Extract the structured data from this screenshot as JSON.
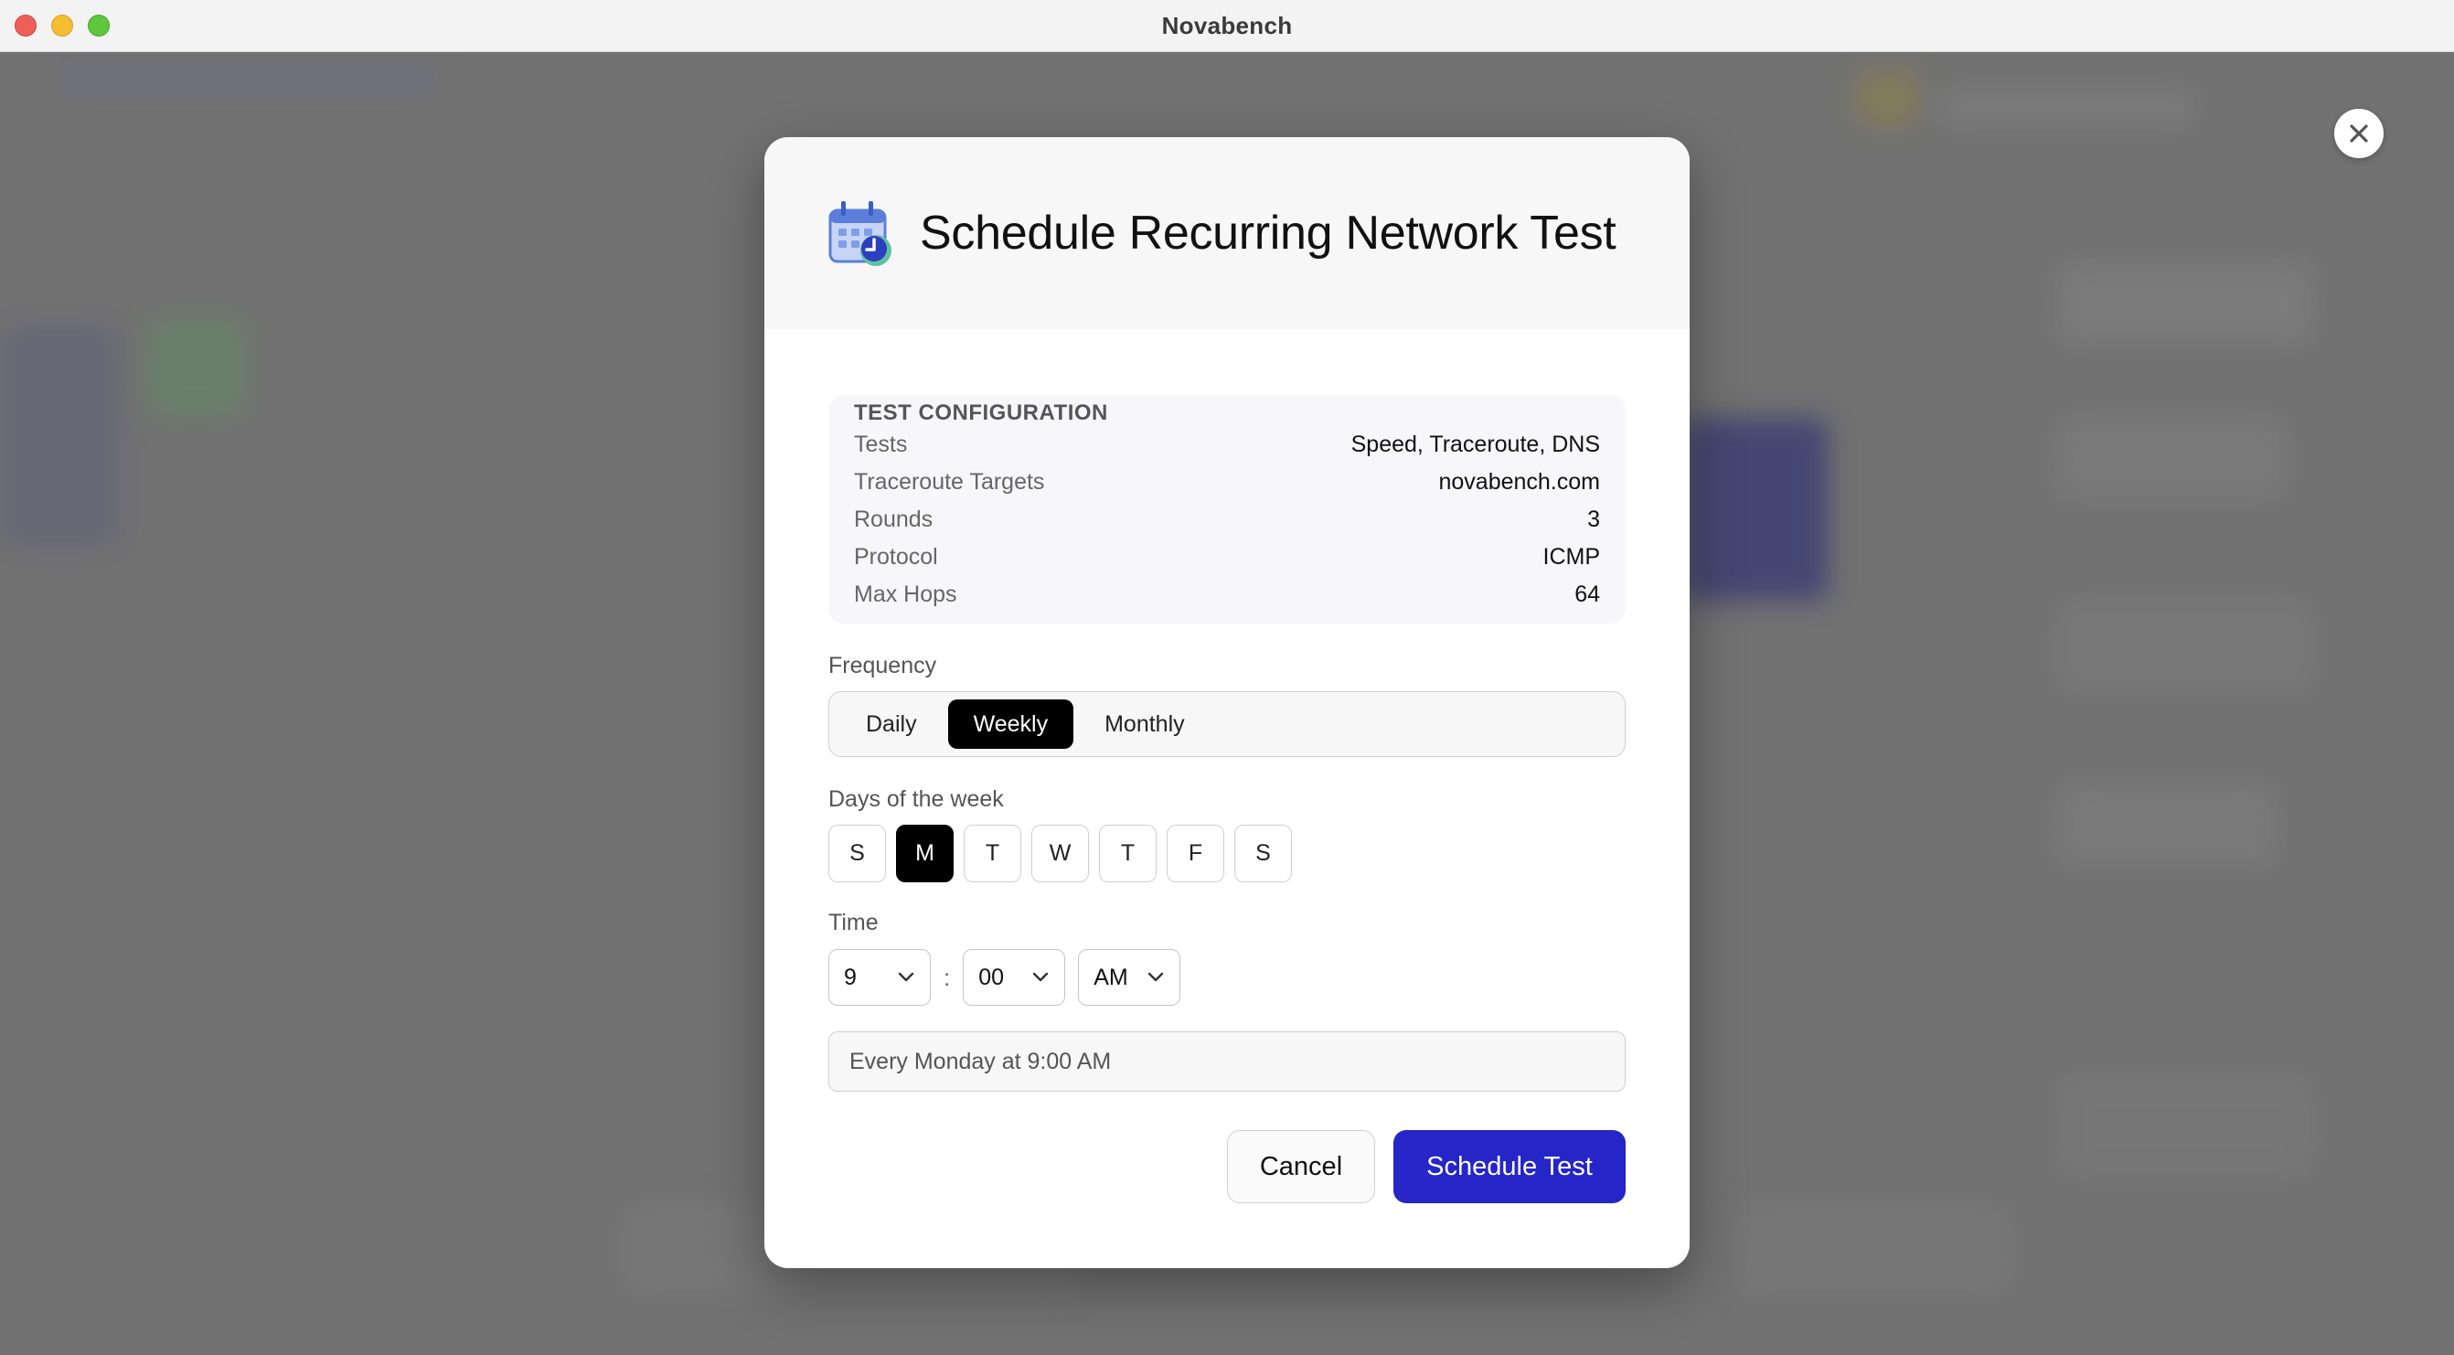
{
  "window": {
    "title": "Novabench"
  },
  "dialog": {
    "title": "Schedule Recurring Network Test",
    "icon": "calendar-clock-icon",
    "close_icon": "close-icon",
    "config": {
      "heading": "TEST CONFIGURATION",
      "rows": [
        {
          "label": "Tests",
          "value": "Speed, Traceroute, DNS"
        },
        {
          "label": "Traceroute Targets",
          "value": "novabench.com"
        },
        {
          "label": "Rounds",
          "value": "3"
        },
        {
          "label": "Protocol",
          "value": "ICMP"
        },
        {
          "label": "Max Hops",
          "value": "64"
        }
      ]
    },
    "frequency": {
      "label": "Frequency",
      "options": [
        "Daily",
        "Weekly",
        "Monthly"
      ],
      "selected": "Weekly"
    },
    "days": {
      "label": "Days of the week",
      "options": [
        "S",
        "M",
        "T",
        "W",
        "T",
        "F",
        "S"
      ],
      "selected_index": 1
    },
    "time": {
      "label": "Time",
      "hour": "9",
      "separator": ":",
      "minute": "00",
      "period": "AM"
    },
    "summary": "Every Monday at 9:00 AM",
    "buttons": {
      "cancel": "Cancel",
      "submit": "Schedule Test"
    },
    "colors": {
      "primary": "#2525c8",
      "selected": "#000000"
    }
  }
}
